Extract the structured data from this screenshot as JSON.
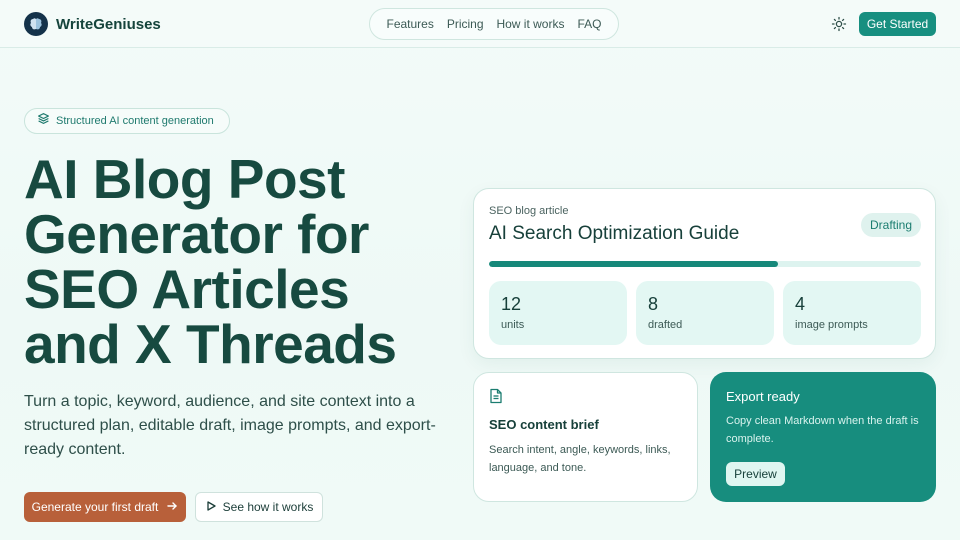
{
  "header": {
    "brand": "WriteGeniuses",
    "nav": [
      "Features",
      "Pricing",
      "How it works",
      "FAQ"
    ],
    "cta": "Get Started"
  },
  "hero": {
    "badge": "Structured AI content generation",
    "title": "AI Blog Post Generator for SEO Articles and X Threads",
    "subtitle": "Turn a topic, keyword, audience, and site context into a structured plan, editable draft, image prompts, and export-ready content.",
    "primary_button": "Generate your first draft",
    "secondary_button": "See how it works"
  },
  "preview_card": {
    "eyebrow": "SEO blog article",
    "title": "AI Search Optimization Guide",
    "status": "Drafting",
    "progress": 0.67,
    "stats": [
      {
        "value": "12",
        "label": "units"
      },
      {
        "value": "8",
        "label": "drafted"
      },
      {
        "value": "4",
        "label": "image prompts"
      }
    ]
  },
  "brief_card": {
    "title": "SEO content brief",
    "text": "Search intent, angle, keywords, links, language, and tone."
  },
  "export_card": {
    "title": "Export ready",
    "text": "Copy clean Markdown when the draft is complete.",
    "button": "Preview"
  },
  "colors": {
    "accent": "#178f80",
    "primary_button": "#b8603a",
    "heading": "#174a40",
    "background": "#f3fbf9"
  },
  "icons": {
    "logo": "brain-logo-icon",
    "theme": "sun-icon",
    "badge": "layers-icon",
    "arrow": "arrow-right-icon",
    "play": "play-icon",
    "brief": "document-icon"
  }
}
